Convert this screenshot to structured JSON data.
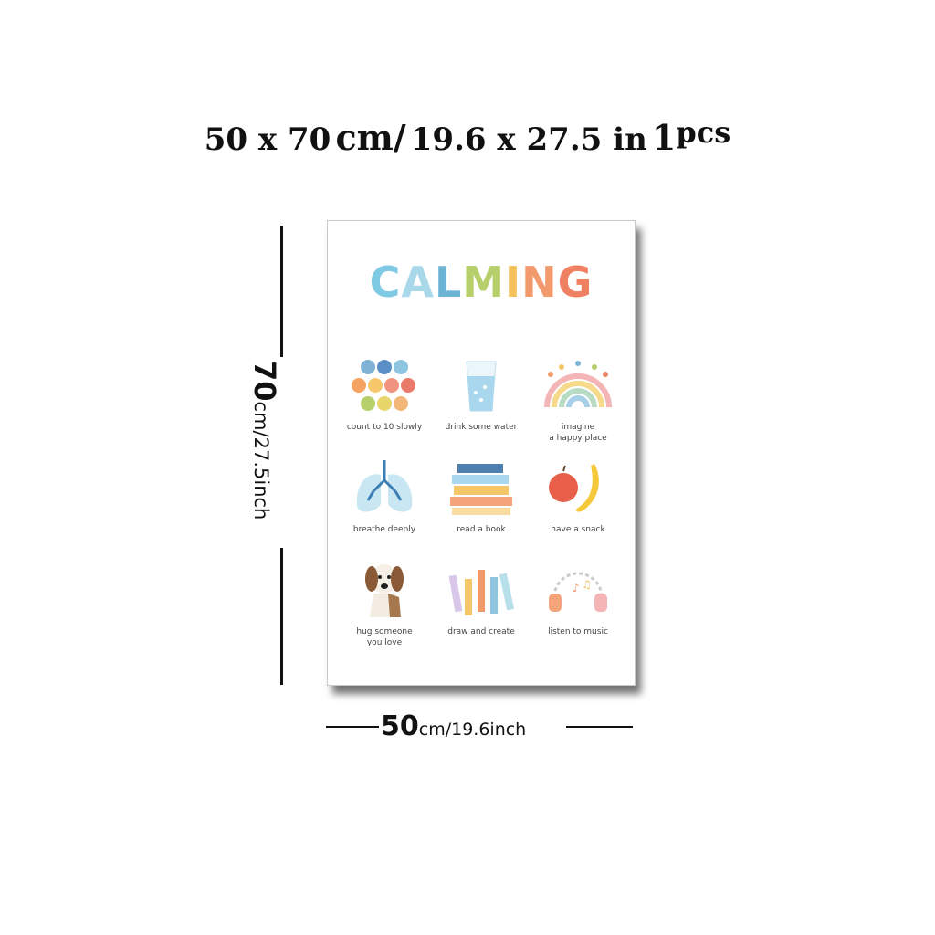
{
  "header": {
    "size_cm": "50 x 70",
    "unit_cm": "cm/",
    "size_in": "19.6 x 27.5 in",
    "qty": "1",
    "qty_unit": "pcs"
  },
  "height_dim": {
    "value": "70",
    "unit": "cm/27.5inch"
  },
  "width_dim": {
    "value": "50",
    "unit": "cm/19.6inch"
  },
  "poster": {
    "title_letters": [
      "C",
      "A",
      "L",
      "M",
      "I",
      "N",
      "G"
    ],
    "title_colors": [
      "#7ec9e3",
      "#a8d8ea",
      "#6cb3d6",
      "#b7cf6a",
      "#f3c05a",
      "#f29a6b",
      "#ef8061"
    ],
    "items": [
      {
        "lines": [
          "count to 10 slowly"
        ],
        "icon": "number-bubbles-icon"
      },
      {
        "lines": [
          "drink some water"
        ],
        "icon": "water-glass-icon"
      },
      {
        "lines": [
          "imagine",
          "a happy place"
        ],
        "icon": "rainbow-icon"
      },
      {
        "lines": [
          "breathe deeply"
        ],
        "icon": "lungs-icon"
      },
      {
        "lines": [
          "read a book"
        ],
        "icon": "books-icon"
      },
      {
        "lines": [
          "have a snack"
        ],
        "icon": "fruit-icon"
      },
      {
        "lines": [
          "hug someone",
          "you love"
        ],
        "icon": "dog-icon"
      },
      {
        "lines": [
          "draw and create"
        ],
        "icon": "pencils-icon"
      },
      {
        "lines": [
          "listen to music"
        ],
        "icon": "headphones-icon"
      }
    ]
  }
}
